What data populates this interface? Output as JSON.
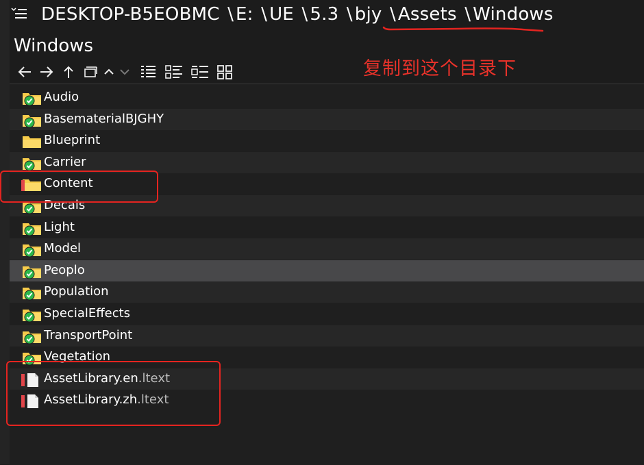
{
  "window": {
    "path_segments": [
      "DESKTOP-B5EOBMC",
      "E:",
      "UE",
      "5.3",
      "bjy",
      "Assets",
      "Windows"
    ],
    "path_separator": "\\",
    "title": "Windows"
  },
  "toolbar": {
    "buttons": [
      "back-arrow-icon",
      "forward-arrow-icon",
      "up-arrow-icon",
      "new-folder-icon",
      "collapse-icon",
      "expand-icon",
      "details-view-icon",
      "list-view-icon",
      "tiles-view-icon",
      "large-icons-view-icon"
    ]
  },
  "annotation": {
    "text": "复制到这个目录下",
    "color": "#e8322a"
  },
  "files": [
    {
      "name": "Audio",
      "type": "folder",
      "status": "synced"
    },
    {
      "name": "BasematerialBJGHY",
      "type": "folder",
      "status": "synced"
    },
    {
      "name": "Blueprint",
      "type": "folder",
      "status": "none"
    },
    {
      "name": "Carrier",
      "type": "folder",
      "status": "synced"
    },
    {
      "name": "Content",
      "type": "folder",
      "status": "modified"
    },
    {
      "name": "Decals",
      "type": "folder",
      "status": "synced"
    },
    {
      "name": "Light",
      "type": "folder",
      "status": "synced"
    },
    {
      "name": "Model",
      "type": "folder",
      "status": "synced"
    },
    {
      "name": "Peoplo",
      "type": "folder",
      "status": "synced",
      "selected": true
    },
    {
      "name": "Population",
      "type": "folder",
      "status": "synced"
    },
    {
      "name": "SpecialEffects",
      "type": "folder",
      "status": "synced"
    },
    {
      "name": "TransportPoint",
      "type": "folder",
      "status": "synced"
    },
    {
      "name": "Vegetation",
      "type": "folder",
      "status": "synced"
    },
    {
      "name": "AssetLibrary.en",
      "ext": ".ltext",
      "type": "file",
      "status": "modified"
    },
    {
      "name": "AssetLibrary.zh",
      "ext": ".ltext",
      "type": "file",
      "status": "modified"
    }
  ],
  "colors": {
    "background": "#1c1c1c",
    "selected_row": "#48484a",
    "folder_yellow": "#f7cc4a",
    "sync_green": "#2db84b",
    "modified_red": "#e2454a",
    "annotation_red": "#e52420"
  }
}
